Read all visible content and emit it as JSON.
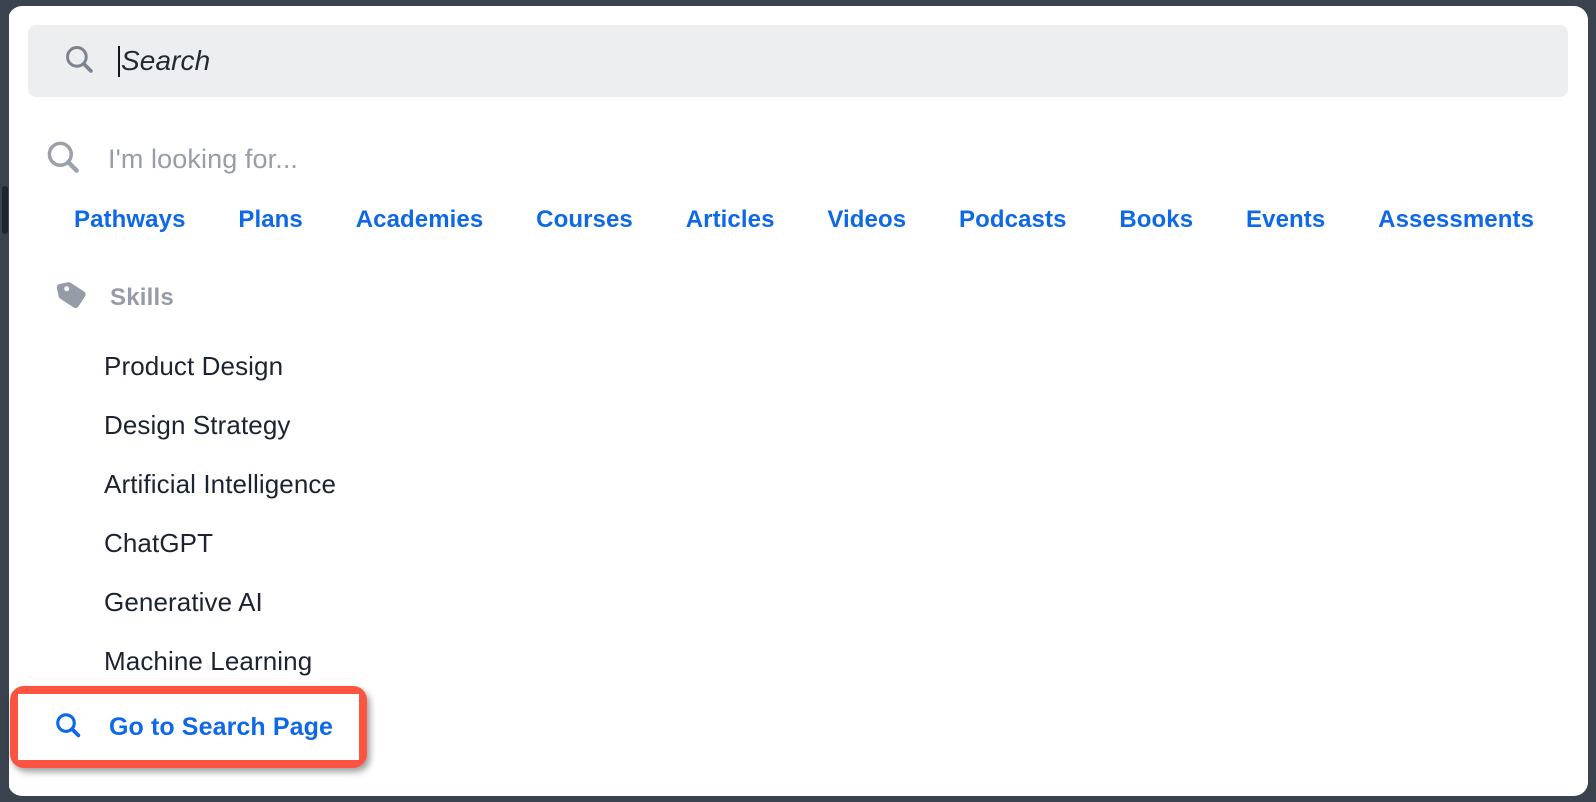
{
  "search_field": {
    "icon": "search-icon",
    "placeholder": "Search",
    "value": "",
    "caret_visible": true,
    "background_color": "#eceef0"
  },
  "suggestion_search_row": {
    "icon": "search-icon",
    "placeholder": "I'm looking for...",
    "text_color": "#979ea7"
  },
  "nav": {
    "accent_color": "#0f68e6",
    "items": [
      {
        "label": "Pathways"
      },
      {
        "label": "Plans"
      },
      {
        "label": "Academies"
      },
      {
        "label": "Courses"
      },
      {
        "label": "Articles"
      },
      {
        "label": "Videos"
      },
      {
        "label": "Podcasts"
      },
      {
        "label": "Books"
      },
      {
        "label": "Events"
      },
      {
        "label": "Assessments"
      }
    ]
  },
  "skills_section": {
    "icon": "tag-icon",
    "header": "Skills",
    "header_color": "#959ca5",
    "items": [
      {
        "label": "Product Design"
      },
      {
        "label": "Design Strategy"
      },
      {
        "label": "Artificial Intelligence"
      },
      {
        "label": "ChatGPT"
      },
      {
        "label": "Generative AI"
      },
      {
        "label": "Machine Learning"
      }
    ]
  },
  "go_to_search": {
    "icon": "search-icon",
    "label": "Go to Search Page",
    "label_color": "#0f68e6",
    "highlight_color": "#fb5441",
    "highlighted": true
  },
  "window": {
    "frame_color": "#3a434e",
    "card_color": "#ffffff"
  }
}
